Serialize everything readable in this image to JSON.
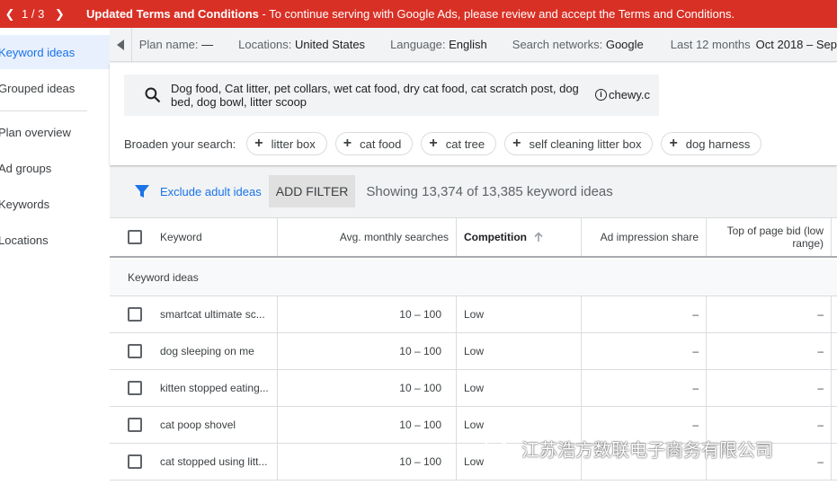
{
  "banner": {
    "pager": "1 / 3",
    "title": "Updated Terms and Conditions",
    "message": " - To continue serving with Google Ads, please review and accept the Terms and Conditions.",
    "color": "#d93025"
  },
  "sidebar": {
    "items": [
      {
        "label": "Keyword ideas",
        "active": true
      },
      {
        "label": "Grouped ideas"
      },
      {
        "label": "Plan overview"
      },
      {
        "label": "Ad groups"
      },
      {
        "label": "Keywords"
      },
      {
        "label": "Locations"
      }
    ]
  },
  "topbar": {
    "plan_label": "Plan name:",
    "plan_value": "—",
    "locations_label": "Locations:",
    "locations_value": "United States",
    "language_label": "Language:",
    "language_value": "English",
    "networks_label": "Search networks:",
    "networks_value": "Google",
    "period_label": "Last 12 months",
    "period_value": "Oct 2018 – Sep"
  },
  "search": {
    "terms": "Dog food, Cat litter, pet collars, wet cat food, dry cat food, cat scratch post, dog bed, dog bowl, litter scoop",
    "site": "chewy.c"
  },
  "broaden": {
    "label": "Broaden your search:",
    "chips": [
      "litter box",
      "cat food",
      "cat tree",
      "self cleaning litter box",
      "dog harness"
    ]
  },
  "filters": {
    "exclude_adult": "Exclude adult ideas",
    "add_filter": "ADD FILTER",
    "showing": "Showing 13,374 of 13,385 keyword ideas"
  },
  "table": {
    "headers": {
      "keyword": "Keyword",
      "avg": "Avg. monthly searches",
      "competition": "Competition",
      "impression": "Ad impression share",
      "bid_line1": "Top of page bid (low",
      "bid_line2": "range)"
    },
    "section": "Keyword ideas",
    "rows": [
      {
        "keyword": "smartcat ultimate sc...",
        "avg": "10 – 100",
        "competition": "Low",
        "impression": "–",
        "bid": "–"
      },
      {
        "keyword": "dog sleeping on me",
        "avg": "10 – 100",
        "competition": "Low",
        "impression": "–",
        "bid": "–"
      },
      {
        "keyword": "kitten stopped eating...",
        "avg": "10 – 100",
        "competition": "Low",
        "impression": "–",
        "bid": "–"
      },
      {
        "keyword": "cat poop shovel",
        "avg": "10 – 100",
        "competition": "Low",
        "impression": "–",
        "bid": "–"
      },
      {
        "keyword": "cat stopped using litt...",
        "avg": "10 – 100",
        "competition": "Low",
        "impression": "",
        "bid": "–"
      }
    ]
  },
  "watermark": "江苏浩方数联电子商务有限公司"
}
